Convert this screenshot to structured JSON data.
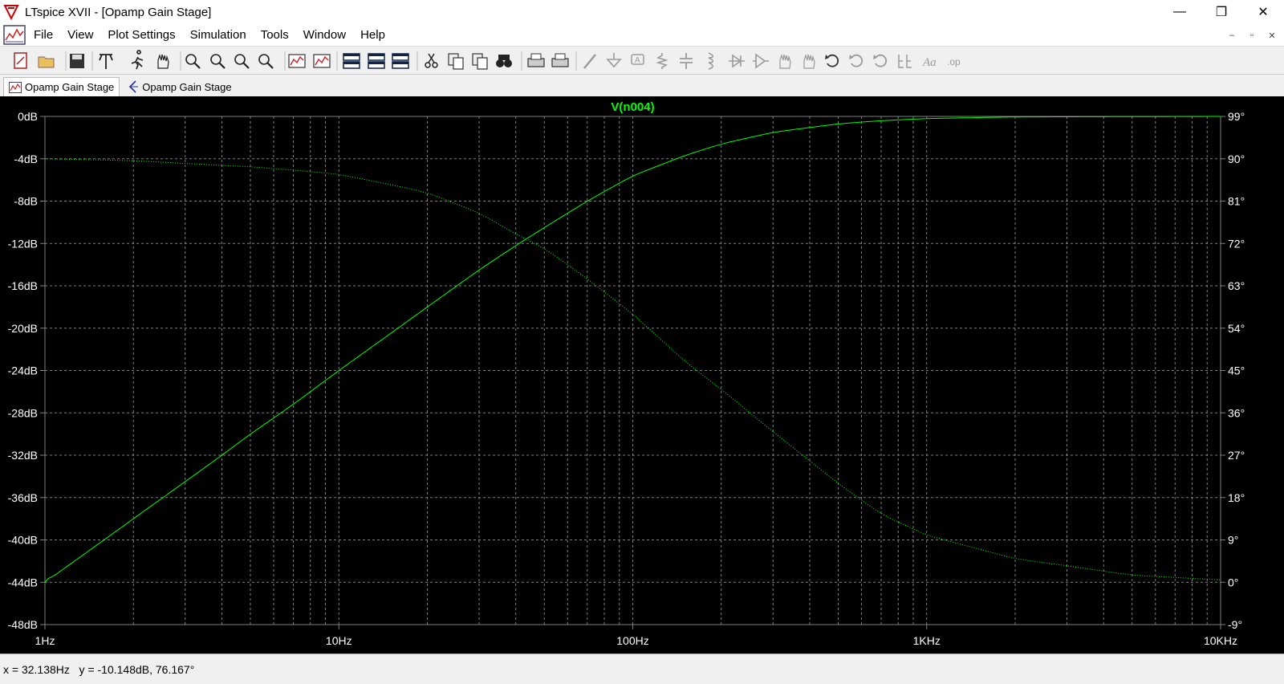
{
  "window": {
    "title": "LTspice XVII - [Opamp Gain Stage]",
    "minimize": "—",
    "maximize": "❐",
    "close": "✕"
  },
  "menu": {
    "items": [
      "File",
      "View",
      "Plot Settings",
      "Simulation",
      "Tools",
      "Window",
      "Help"
    ]
  },
  "mdi": {
    "minimize": "–",
    "restore": "▫",
    "close": "✕"
  },
  "toolbar": {
    "icons": [
      "new-schematic-icon",
      "open-icon",
      "save-icon",
      "control-panel-icon",
      "run-icon",
      "halt-icon",
      "zoom-area-icon",
      "zoom-in-icon",
      "zoom-out-icon",
      "zoom-cancel-icon",
      "autorange-icon",
      "pick-visible-traces-icon",
      "tile-horizontal-icon",
      "cascade-icon",
      "tile-vertical-icon",
      "cut-icon",
      "copy-icon",
      "paste-icon",
      "find-icon",
      "print-setup-icon",
      "print-icon",
      "draw-wire-icon",
      "ground-icon",
      "label-net-icon",
      "resistor-icon",
      "capacitor-icon",
      "inductor-icon",
      "diode-icon",
      "component-icon",
      "move-icon",
      "drag-icon",
      "undo-icon",
      "redo-icon",
      "rotate-icon",
      "mirror-icon",
      "text-icon",
      "spice-directive-icon"
    ]
  },
  "tabs": [
    {
      "label": "Opamp Gain Stage",
      "active": true,
      "icon": "waveform-tab-icon"
    },
    {
      "label": "Opamp Gain Stage",
      "active": false,
      "icon": "schematic-tab-icon"
    }
  ],
  "status": {
    "text": "x = 32.138Hz   y = -10.148dB, 76.167°"
  },
  "chart_data": {
    "type": "line",
    "title": "V(n004)",
    "xscale": "log",
    "xlim": [
      1,
      10000
    ],
    "x_ticks": [
      "1Hz",
      "10Hz",
      "100Hz",
      "1KHz",
      "10KHz"
    ],
    "ylim_left": [
      -48,
      0
    ],
    "ylim_right": [
      -9,
      99
    ],
    "y_ticks_left": [
      "0dB",
      "-4dB",
      "-8dB",
      "-12dB",
      "-16dB",
      "-20dB",
      "-24dB",
      "-28dB",
      "-32dB",
      "-36dB",
      "-40dB",
      "-44dB",
      "-48dB"
    ],
    "y_ticks_right": [
      "99°",
      "90°",
      "81°",
      "72°",
      "63°",
      "54°",
      "45°",
      "36°",
      "27°",
      "18°",
      "9°",
      "0°",
      "-9°"
    ],
    "grid": true,
    "colors": {
      "background": "#000000",
      "grid": "#808080",
      "trace": "#00ff00",
      "text": "#ffffff",
      "title": "#00ff00"
    },
    "series": [
      {
        "name": "V(n004)",
        "axis": "left",
        "style": "solid",
        "x": [
          1,
          1.5,
          2,
          3,
          4,
          5,
          7,
          10,
          15,
          20,
          30,
          40,
          50,
          70,
          100,
          150,
          200,
          300,
          500,
          700,
          1000,
          2000,
          5000,
          10000
        ],
        "values": [
          -44,
          -40.5,
          -38,
          -34.5,
          -32,
          -30,
          -27.2,
          -24,
          -20.5,
          -18,
          -14.5,
          -12.2,
          -10.5,
          -8,
          -5.6,
          -3.7,
          -2.6,
          -1.5,
          -0.7,
          -0.4,
          -0.2,
          -0.05,
          -0.02,
          0
        ]
      },
      {
        "name": "phase",
        "axis": "right",
        "style": "dotted",
        "x": [
          1,
          2,
          3,
          5,
          7,
          10,
          15,
          20,
          30,
          40,
          50,
          70,
          100,
          150,
          200,
          300,
          500,
          700,
          1000,
          2000,
          3000,
          5000,
          10000
        ],
        "values": [
          90,
          89.6,
          89,
          88.3,
          87.6,
          86.7,
          84.5,
          82.8,
          78.5,
          74,
          71,
          64.5,
          57,
          47,
          41,
          32,
          21,
          14.5,
          10,
          5,
          3.5,
          1.5,
          0.5
        ]
      }
    ]
  }
}
